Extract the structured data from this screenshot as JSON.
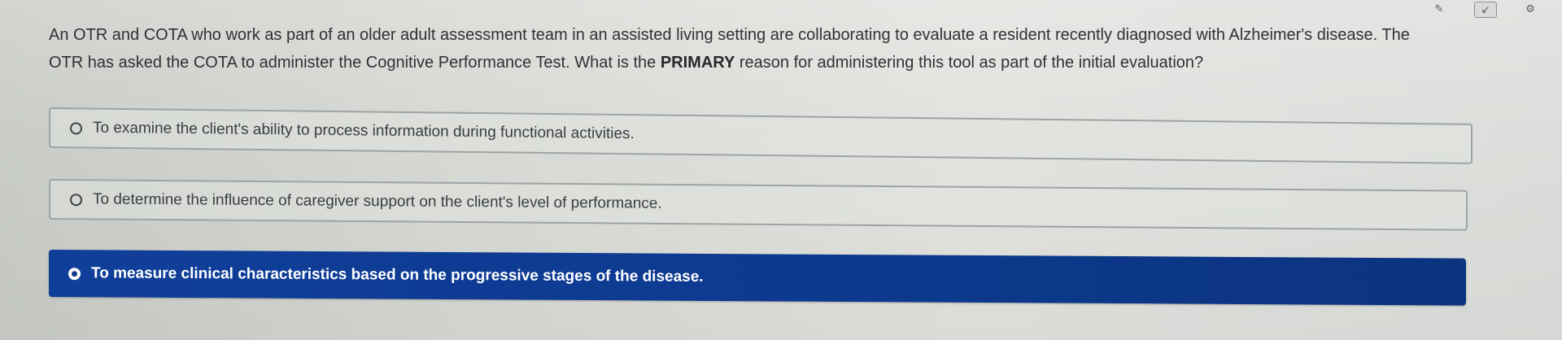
{
  "toolbar": {
    "pen_glyph": "✎",
    "collapse_glyph": "↙",
    "gear_glyph": "⚙"
  },
  "question": {
    "text_before": "An OTR and COTA who work as part of an older adult assessment team in an assisted living setting are collaborating to evaluate a resident recently diagnosed with Alzheimer's disease. The OTR has asked the COTA to administer the Cognitive Performance Test. What is the ",
    "emphasis": "PRIMARY",
    "text_after": " reason for administering this tool as part of the initial evaluation?"
  },
  "options": [
    {
      "label": "To examine the client's ability to process information during functional activities.",
      "selected": false
    },
    {
      "label": "To determine the influence of caregiver support on the client's level of performance.",
      "selected": false
    },
    {
      "label": "To measure clinical characteristics based on the progressive stages of the disease.",
      "selected": true
    }
  ],
  "colors": {
    "selected_background": "#0d3a8f",
    "selected_text": "#ffffff",
    "option_border": "#9ea3a7"
  },
  "icons": {
    "pen": "pen-icon",
    "collapse": "collapse-icon",
    "settings": "gear-icon",
    "radio": "radio-button"
  }
}
